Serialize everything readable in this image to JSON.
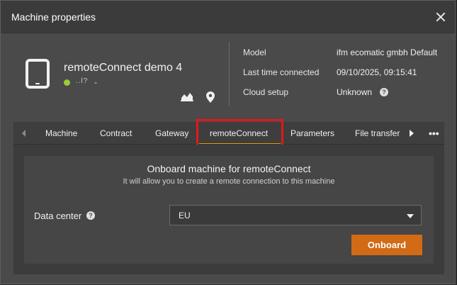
{
  "dialog": {
    "title": "Machine properties"
  },
  "machine": {
    "name": "remoteConnect demo 4",
    "signal": "..l?",
    "status_extra": "-",
    "status_color": "#9acd32"
  },
  "properties": {
    "model_label": "Model",
    "model_value": "ifm ecomatic gmbh Default",
    "last_connected_label": "Last time connected",
    "last_connected_value": "09/10/2025, 09:15:41",
    "cloud_setup_label": "Cloud setup",
    "cloud_setup_value": "Unknown"
  },
  "tabs": {
    "items": [
      {
        "label": "Machine"
      },
      {
        "label": "Contract"
      },
      {
        "label": "Gateway"
      },
      {
        "label": "remoteConnect"
      },
      {
        "label": "Parameters"
      },
      {
        "label": "File transfer"
      }
    ],
    "more_label": "•••",
    "active": "remoteConnect"
  },
  "onboard_panel": {
    "title": "Onboard machine for remoteConnect",
    "subtitle": "It will allow you to create a remote connection to this machine",
    "data_center_label": "Data center",
    "data_center_value": "EU",
    "button_label": "Onboard"
  },
  "colors": {
    "accent": "#d26a16",
    "highlight": "#e0191b"
  },
  "icons": {
    "help": "?"
  }
}
